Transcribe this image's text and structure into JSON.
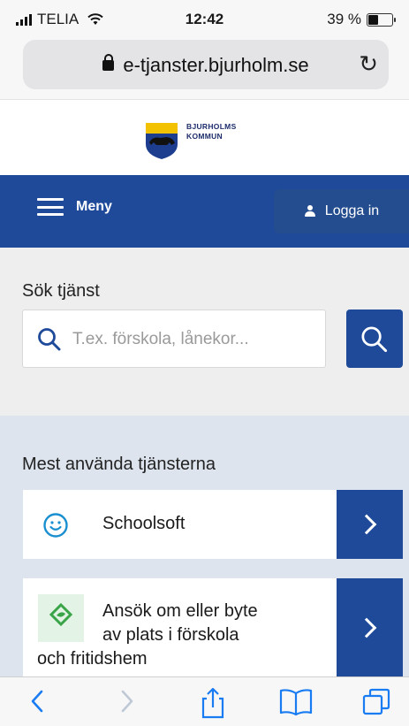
{
  "status_bar": {
    "carrier": "TELIA",
    "time": "12:42",
    "battery_percent": "39 %",
    "battery_level": 0.39
  },
  "browser": {
    "url": "e-tjanster.bjurholm.se"
  },
  "logo": {
    "line1": "BJURHOLMS",
    "line2": "KOMMUN"
  },
  "nav": {
    "menu_label": "Meny",
    "login_label": "Logga in"
  },
  "search": {
    "title": "Sök tjänst",
    "placeholder": "T.ex. förskola, lånekor..."
  },
  "popular": {
    "title": "Mest använda tjänsterna",
    "items": [
      {
        "label": "Schoolsoft",
        "icon": "smiley-icon"
      },
      {
        "label_line1": "Ansök om eller byte",
        "label_line2": "av plats i förskola",
        "label_line3": "och fritidshem",
        "icon": "diamond-leaf-icon"
      }
    ]
  },
  "colors": {
    "brand_blue": "#1f4a9a",
    "search_bg": "#eeeeee",
    "popular_bg": "#dde4ee",
    "ios_blue": "#1a7cf2"
  }
}
